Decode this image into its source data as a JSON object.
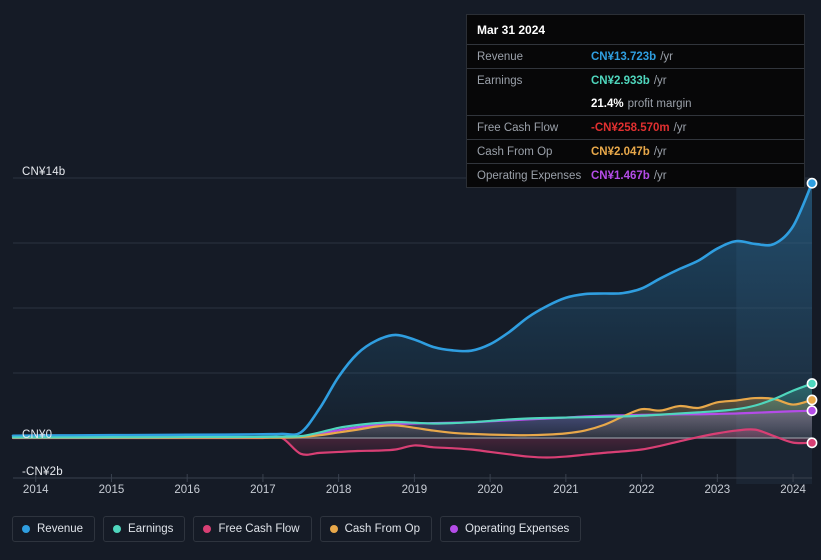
{
  "colors": {
    "background": "#151b26",
    "revenue": "#2f9ee0",
    "earnings": "#4fd6bd",
    "free_cash_flow": "#d83f74",
    "cash_from_op": "#e8a84a",
    "operating_expenses": "#b44ce8",
    "grid": "#2b3340",
    "zero_line": "#9aa0a8",
    "tooltip_bg": "#070708",
    "negative": "#e03030"
  },
  "tooltip": {
    "title": "Mar 31 2024",
    "rows": [
      {
        "label": "Revenue",
        "value": "CN¥13.723b",
        "unit": "/yr",
        "color": "#2f9ee0"
      },
      {
        "label": "Earnings",
        "value": "CN¥2.933b",
        "unit": "/yr",
        "color": "#4fd6bd"
      },
      {
        "label": "Free Cash Flow",
        "value": "-CN¥258.570m",
        "unit": "/yr",
        "color": "#e03030"
      },
      {
        "label": "Cash From Op",
        "value": "CN¥2.047b",
        "unit": "/yr",
        "color": "#e8a84a"
      },
      {
        "label": "Operating Expenses",
        "value": "CN¥1.467b",
        "unit": "/yr",
        "color": "#b44ce8"
      }
    ],
    "profit_margin": {
      "value": "21.4%",
      "text": "profit margin"
    }
  },
  "legend": [
    {
      "label": "Revenue",
      "color": "#2f9ee0"
    },
    {
      "label": "Earnings",
      "color": "#4fd6bd"
    },
    {
      "label": "Free Cash Flow",
      "color": "#d83f74"
    },
    {
      "label": "Cash From Op",
      "color": "#e8a84a"
    },
    {
      "label": "Operating Expenses",
      "color": "#b44ce8"
    }
  ],
  "axis": {
    "y_labels": [
      {
        "text": "CN¥14b",
        "y": 166
      },
      {
        "text": "CN¥0",
        "y": 429
      },
      {
        "text": "-CN¥2b",
        "y": 466
      }
    ],
    "x_labels": [
      "2014",
      "2015",
      "2016",
      "2017",
      "2018",
      "2019",
      "2020",
      "2021",
      "2022",
      "2023",
      "2024"
    ]
  },
  "chart_data": {
    "type": "line",
    "title": "",
    "xlabel": "",
    "ylabel": "CN¥",
    "xlim": [
      2013.7,
      2024.25
    ],
    "ylim": [
      -2,
      14
    ],
    "grid": true,
    "legend_position": "bottom",
    "x_ticks": [
      2014,
      2015,
      2016,
      2017,
      2018,
      2019,
      2020,
      2021,
      2022,
      2023,
      2024
    ],
    "y_ticks": [
      -2,
      0,
      3.5,
      7,
      10.5,
      14
    ],
    "y_tick_labels": [
      "-CN¥2b",
      "CN¥0",
      "",
      "",
      "",
      "CN¥14b"
    ],
    "forecast_start": 2023.25,
    "x": [
      2013.7,
      2014.0,
      2014.5,
      2015.0,
      2015.5,
      2016.0,
      2016.5,
      2017.0,
      2017.25,
      2017.5,
      2017.75,
      2018.0,
      2018.25,
      2018.5,
      2018.75,
      2019.0,
      2019.25,
      2019.5,
      2019.75,
      2020.0,
      2020.25,
      2020.5,
      2020.75,
      2021.0,
      2021.25,
      2021.5,
      2021.75,
      2022.0,
      2022.25,
      2022.5,
      2022.75,
      2023.0,
      2023.25,
      2023.5,
      2023.75,
      2024.0,
      2024.25
    ],
    "series": [
      {
        "name": "Revenue",
        "color": "#2f9ee0",
        "values": [
          0.12,
          0.13,
          0.14,
          0.15,
          0.16,
          0.17,
          0.18,
          0.2,
          0.22,
          0.3,
          1.6,
          3.3,
          4.55,
          5.25,
          5.55,
          5.3,
          4.9,
          4.72,
          4.7,
          5.05,
          5.7,
          6.5,
          7.1,
          7.55,
          7.75,
          7.78,
          7.8,
          8.05,
          8.6,
          9.1,
          9.55,
          10.2,
          10.6,
          10.45,
          10.45,
          11.4,
          13.72
        ]
      },
      {
        "name": "Earnings",
        "color": "#4fd6bd",
        "values": [
          0.03,
          0.03,
          0.03,
          0.04,
          0.04,
          0.05,
          0.05,
          0.06,
          0.07,
          0.1,
          0.3,
          0.55,
          0.7,
          0.8,
          0.86,
          0.82,
          0.78,
          0.8,
          0.85,
          0.92,
          1.0,
          1.05,
          1.08,
          1.1,
          1.12,
          1.14,
          1.16,
          1.2,
          1.26,
          1.32,
          1.38,
          1.45,
          1.55,
          1.75,
          2.1,
          2.55,
          2.93
        ]
      },
      {
        "name": "Free Cash Flow",
        "color": "#d83f74",
        "values": [
          0.0,
          0.0,
          0.0,
          0.0,
          0.0,
          0.0,
          0.0,
          0.0,
          0.0,
          -0.85,
          -0.8,
          -0.75,
          -0.7,
          -0.68,
          -0.62,
          -0.4,
          -0.5,
          -0.55,
          -0.62,
          -0.75,
          -0.88,
          -1.0,
          -1.05,
          -1.0,
          -0.9,
          -0.8,
          -0.72,
          -0.62,
          -0.42,
          -0.18,
          0.05,
          0.25,
          0.4,
          0.45,
          0.1,
          -0.25,
          -0.26
        ]
      },
      {
        "name": "Cash From Op",
        "color": "#e8a84a",
        "values": [
          0.01,
          0.01,
          0.01,
          0.01,
          0.01,
          0.02,
          0.02,
          0.02,
          0.02,
          0.05,
          0.15,
          0.3,
          0.45,
          0.62,
          0.68,
          0.55,
          0.4,
          0.28,
          0.22,
          0.18,
          0.16,
          0.15,
          0.18,
          0.25,
          0.4,
          0.7,
          1.15,
          1.55,
          1.48,
          1.72,
          1.62,
          1.92,
          2.02,
          2.15,
          2.1,
          1.8,
          2.05
        ]
      },
      {
        "name": "Operating Expenses",
        "color": "#b44ce8",
        "values": [
          0.02,
          0.02,
          0.02,
          0.02,
          0.03,
          0.03,
          0.03,
          0.04,
          0.04,
          0.08,
          0.22,
          0.42,
          0.58,
          0.7,
          0.76,
          0.78,
          0.8,
          0.82,
          0.85,
          0.9,
          0.95,
          1.0,
          1.05,
          1.1,
          1.16,
          1.2,
          1.22,
          1.25,
          1.26,
          1.28,
          1.28,
          1.3,
          1.32,
          1.36,
          1.4,
          1.44,
          1.47
        ]
      }
    ]
  }
}
